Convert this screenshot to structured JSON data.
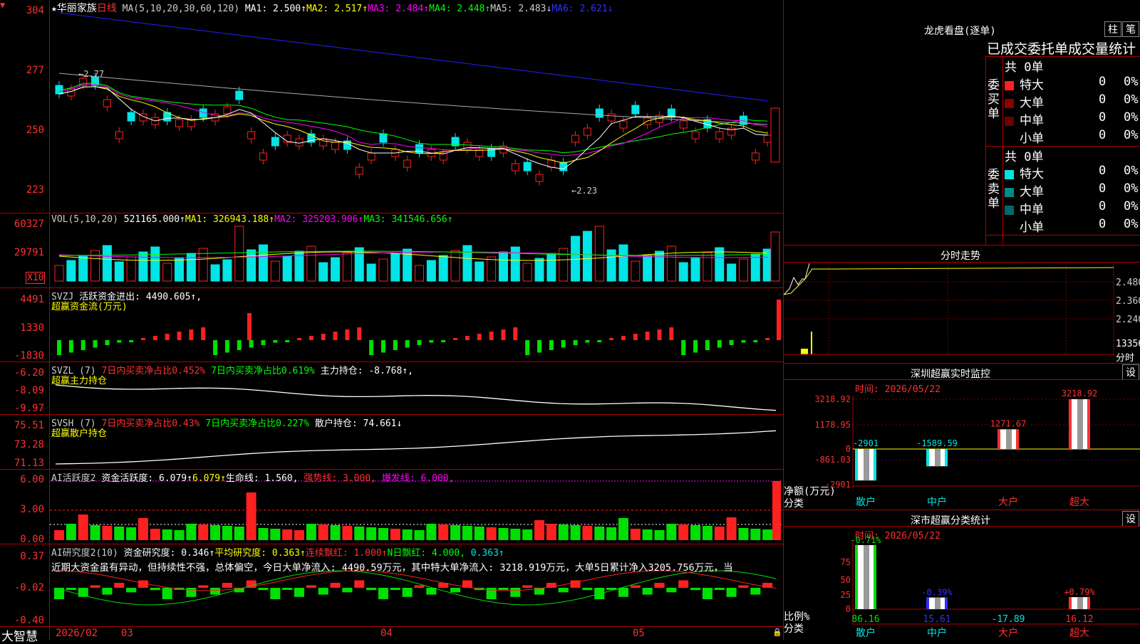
{
  "colors": {
    "up": "#ff2020",
    "down": "#00e5e5",
    "frame": "#b00000",
    "ma1": "#ffffff",
    "ma2": "#ffff00",
    "ma3": "#ff00ff",
    "ma4": "#00ff00",
    "ma5": "#aaaaaa",
    "ma6": "#2020ff",
    "green": "#00e000"
  },
  "main": {
    "star": "★",
    "name": "华丽家族",
    "period": "日线",
    "ma_set": "MA(5,10,20,30,60,120)",
    "ma1": "MA1: 2.500↑",
    "ma2": "MA2: 2.517↑",
    "ma3": "MA3: 2.484↑",
    "ma4": "MA4: 2.448↑",
    "ma5": "MA5: 2.483↓",
    "ma6": "MA6: 2.621↓",
    "y_ticks": [
      "304",
      "277",
      "250",
      "223"
    ],
    "high_label": "←2.77",
    "low_label": "←2.23"
  },
  "vol": {
    "label": "VOL(5,10,20)",
    "value": "521165.000↑",
    "ma1": "MA1: 326943.188↑",
    "ma2": "MA2: 325203.906↑",
    "ma3": "MA3: 341546.656↑",
    "y_ticks": [
      "60327",
      "29791"
    ],
    "unit": "X10"
  },
  "svzj": {
    "label": "SVZJ",
    "title": "活跃资金进出: 4490.605↑,",
    "subtitle": "超赢资金流(万元)",
    "y_ticks": [
      "4491",
      "1330",
      "-1830"
    ]
  },
  "svzl": {
    "label": "SVZL (7)",
    "a": "7日内买卖净占比0.452%",
    "b": "7日内买卖净占比0.619%",
    "c": "主力持仓: -8.768↑,",
    "subtitle": "超赢主力持仓",
    "y_ticks": [
      "-6.20",
      "-8.09",
      "-9.97"
    ]
  },
  "svsh": {
    "label": "SVSH (7)",
    "a": "7日内买卖净占比0.43%",
    "b": "7日内买卖净占比0.227%",
    "c": "散户持仓: 74.661↓",
    "subtitle": "超赢散户持仓",
    "y_ticks": [
      "75.51",
      "73.28",
      "71.13"
    ]
  },
  "ai1": {
    "label": "AI活跃度2",
    "a": "资金活跃度: 6.079↑",
    "b": "6.079↑",
    "c": "生命线: 1.560,",
    "d": "强势线: 3.000,",
    "e": "爆发线: 6.000,",
    "y_ticks": [
      "6.00",
      "3.00",
      "0.00"
    ]
  },
  "ai2": {
    "label": "AI研究度2(10)",
    "a": "资金研究度: 0.346↑",
    "b": "平均研究度: 0.363↑",
    "c": "连续飘红: 1.000↑",
    "d": "N日飘红: 4.000,",
    "e": "0.363↑",
    "comment": "近期大资金虽有异动，但持续性不强，总体偏空，今日大单净流入: 4490.59万元，其中特大单净流入: 3218.919万元，大单5日累计净入3205.756万元，当",
    "y_ticks": [
      "0.37",
      "-0.02",
      "-0.40"
    ]
  },
  "bottom_axis": {
    "logo": "大智慧",
    "labels": [
      "2026/02",
      "03",
      "04",
      "05"
    ]
  },
  "lhkp": {
    "title": "龙虎看盘(逐单)",
    "btn1": "柱",
    "btn2": "笔",
    "header": "已成交委托单成交量统计",
    "buy_label": "委买单",
    "sell_label": "委卖单",
    "buy_total": "共 0单",
    "sell_total": "共 0单",
    "buy_rows": [
      {
        "name": "特大",
        "count": "0",
        "pct": "0%",
        "color": "#ff2020"
      },
      {
        "name": "大单",
        "count": "0",
        "pct": "0%",
        "color": "#8b0000"
      },
      {
        "name": "中单",
        "count": "0",
        "pct": "0%",
        "color": "#6b0000"
      },
      {
        "name": "小单",
        "count": "0",
        "pct": "0%",
        "color": "#000000"
      }
    ],
    "sell_rows": [
      {
        "name": "特大",
        "count": "0",
        "pct": "0%",
        "color": "#00e5e5"
      },
      {
        "name": "大单",
        "count": "0",
        "pct": "0%",
        "color": "#008a8a"
      },
      {
        "name": "中单",
        "count": "0",
        "pct": "0%",
        "color": "#006a6a"
      },
      {
        "name": "小单",
        "count": "0",
        "pct": "0%",
        "color": "#000000"
      }
    ]
  },
  "fenshi": {
    "title": "分时走势",
    "y_ticks": [
      "2.480",
      "2.360",
      "2.240"
    ],
    "vol_tick": "13356",
    "unit": "分时"
  },
  "sz_monitor": {
    "title": "深圳超赢实时监控",
    "btn": "设",
    "time": "时间: 2026/05/22",
    "y_ticks": [
      "3218.92",
      "1178.95",
      "0",
      "-861.03",
      "-2901"
    ],
    "ylabel": "净额(万元)",
    "xlabel": "分类",
    "categories": [
      "散户",
      "中户",
      "大户",
      "超大"
    ],
    "values": [
      -2901,
      -1589.59,
      1271.67,
      3218.92
    ],
    "value_labels": [
      "-2901",
      "-1589.59",
      "1271.67",
      "3218.92"
    ]
  },
  "sz_class": {
    "title": "深市超赢分类统计",
    "btn": "设",
    "time": "时间: 2026/05/22",
    "y_ticks": [
      "75",
      "50",
      "25",
      "0"
    ],
    "ylabel": "比例%",
    "xlabel": "分类",
    "categories": [
      "散户",
      "中户",
      "大户",
      "超大"
    ],
    "values": [
      86.16,
      15.61,
      -17.89,
      16.12
    ],
    "top_labels": [
      "-0.71%",
      "-0.39%",
      "",
      "+0.79%"
    ],
    "value_labels": [
      "86.16",
      "15.61",
      "-17.89",
      "16.12"
    ]
  }
}
